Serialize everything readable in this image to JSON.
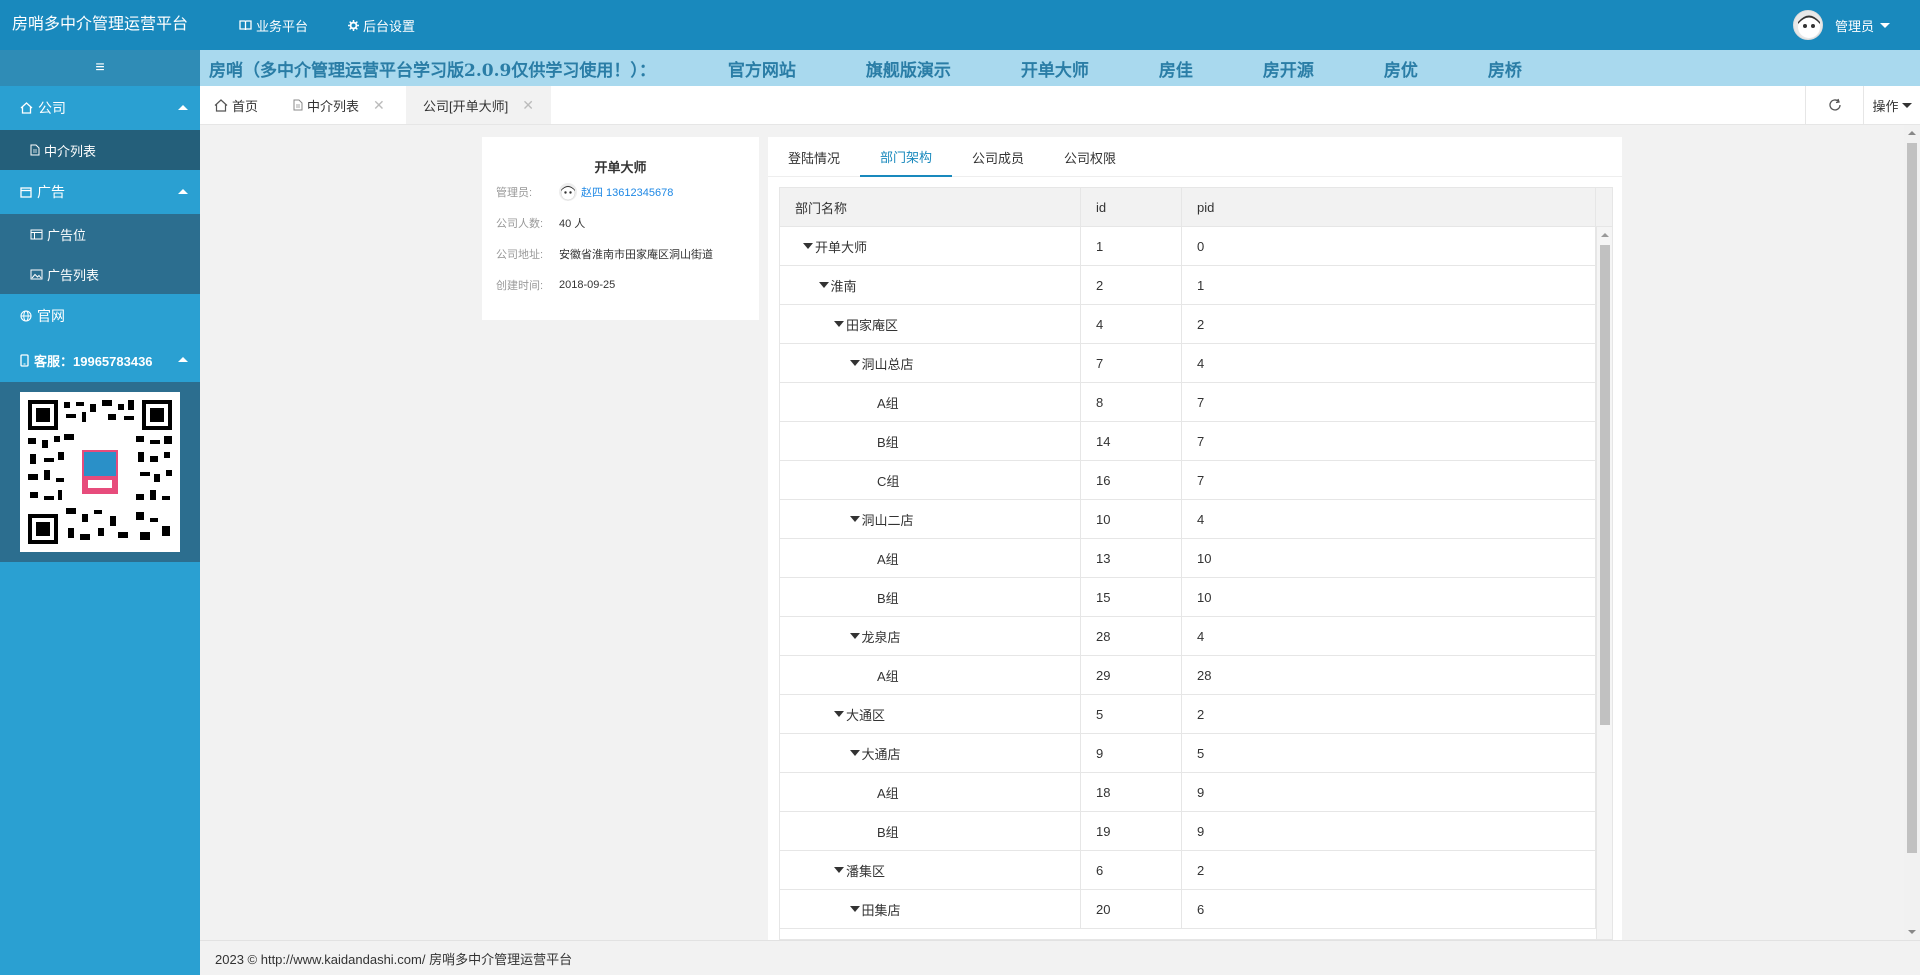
{
  "header": {
    "logo": "房哨多中介管理运营平台",
    "nav": [
      {
        "label": "业务平台",
        "icon": "book-icon"
      },
      {
        "label": "后台设置",
        "icon": "gear-icon"
      }
    ],
    "user": "管理员"
  },
  "sidebar": {
    "toggle": "≡",
    "groups": [
      {
        "label": "公司",
        "icon": "home-icon",
        "items": [
          {
            "label": "中介列表",
            "icon": "file-icon"
          }
        ]
      },
      {
        "label": "广告",
        "icon": "window-icon",
        "items": [
          {
            "label": "广告位",
            "icon": "window-icon"
          },
          {
            "label": "广告列表",
            "icon": "image-icon"
          }
        ]
      },
      {
        "label": "官网",
        "icon": "globe-icon",
        "items": []
      },
      {
        "label": "客服：19965783436",
        "icon": "phone-icon",
        "items": []
      }
    ]
  },
  "banner": {
    "text": "房哨（多中介管理运营平台学习版2.0.9仅供学习使用！）：",
    "links": [
      "官方网站",
      "旗舰版演示",
      "开单大师",
      "房佳",
      "房开源",
      "房优",
      "房桥"
    ]
  },
  "tabs": [
    {
      "label": "首页",
      "icon": "home-icon",
      "closable": false
    },
    {
      "label": "中介列表",
      "icon": "file-icon",
      "closable": true
    },
    {
      "label": "公司[开单大师]",
      "icon": "",
      "closable": true
    }
  ],
  "toolbar": {
    "operations": "操作"
  },
  "company": {
    "name": "开单大师",
    "admin_label": "管理员:",
    "admin_value": "赵四 13612345678",
    "count_label": "公司人数:",
    "count_value": "40 人",
    "address_label": "公司地址:",
    "address_value": "安徽省淮南市田家庵区洞山街道",
    "created_label": "创建时间:",
    "created_value": "2018-09-25"
  },
  "panel": {
    "tabs": [
      "登陆情况",
      "部门架构",
      "公司成员",
      "公司权限"
    ],
    "active_tab": 1,
    "columns": [
      "部门名称",
      "id",
      "pid"
    ],
    "rows": [
      {
        "name": "开单大师",
        "level": 0,
        "expanded": true,
        "id": "1",
        "pid": "0"
      },
      {
        "name": "淮南",
        "level": 1,
        "expanded": true,
        "id": "2",
        "pid": "1"
      },
      {
        "name": "田家庵区",
        "level": 2,
        "expanded": true,
        "id": "4",
        "pid": "2"
      },
      {
        "name": "洞山总店",
        "level": 3,
        "expanded": true,
        "id": "7",
        "pid": "4"
      },
      {
        "name": "A组",
        "level": 4,
        "expanded": false,
        "id": "8",
        "pid": "7"
      },
      {
        "name": "B组",
        "level": 4,
        "expanded": false,
        "id": "14",
        "pid": "7"
      },
      {
        "name": "C组",
        "level": 4,
        "expanded": false,
        "id": "16",
        "pid": "7"
      },
      {
        "name": "洞山二店",
        "level": 3,
        "expanded": true,
        "id": "10",
        "pid": "4"
      },
      {
        "name": "A组",
        "level": 4,
        "expanded": false,
        "id": "13",
        "pid": "10"
      },
      {
        "name": "B组",
        "level": 4,
        "expanded": false,
        "id": "15",
        "pid": "10"
      },
      {
        "name": "龙泉店",
        "level": 3,
        "expanded": true,
        "id": "28",
        "pid": "4"
      },
      {
        "name": "A组",
        "level": 4,
        "expanded": false,
        "id": "29",
        "pid": "28"
      },
      {
        "name": "大通区",
        "level": 2,
        "expanded": true,
        "id": "5",
        "pid": "2"
      },
      {
        "name": "大通店",
        "level": 3,
        "expanded": true,
        "id": "9",
        "pid": "5"
      },
      {
        "name": "A组",
        "level": 4,
        "expanded": false,
        "id": "18",
        "pid": "9"
      },
      {
        "name": "B组",
        "level": 4,
        "expanded": false,
        "id": "19",
        "pid": "9"
      },
      {
        "name": "潘集区",
        "level": 2,
        "expanded": true,
        "id": "6",
        "pid": "2"
      },
      {
        "name": "田集店",
        "level": 3,
        "expanded": true,
        "id": "20",
        "pid": "6"
      }
    ]
  },
  "footer": {
    "text": "2023 © http://www.kaidandashi.com/ 房哨多中介管理运营平台"
  },
  "colors": {
    "header": "#1989bd",
    "sidebar": "#2aa0d2",
    "banner": "#a9d9ee",
    "accent": "#1989bd"
  }
}
